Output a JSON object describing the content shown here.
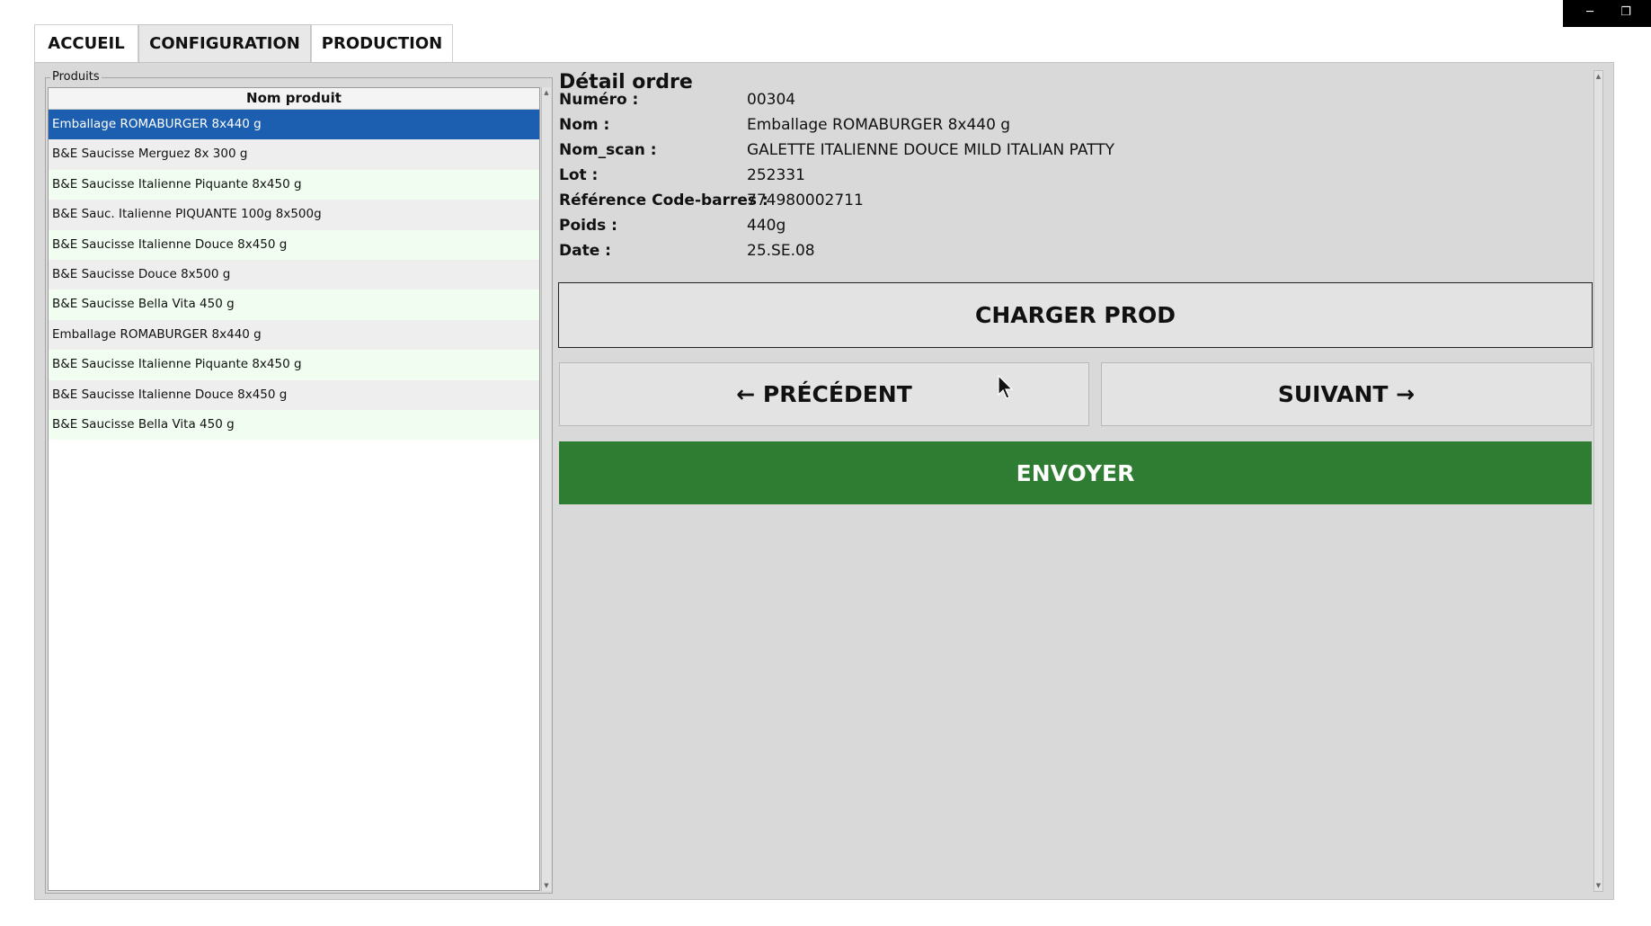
{
  "window": {
    "minimize_icon": "─",
    "restore_icon": "❐"
  },
  "tabs": [
    {
      "label": "ACCUEIL"
    },
    {
      "label": "CONFIGURATION",
      "active": true
    },
    {
      "label": "PRODUCTION"
    }
  ],
  "products": {
    "group_title": "Produits",
    "column_header": "Nom produit",
    "items": [
      "Emballage ROMABURGER 8x440 g",
      "B&E Saucisse Merguez 8x 300 g",
      "B&E Saucisse Italienne Piquante 8x450 g",
      "B&E Sauc. Italienne PIQUANTE 100g  8x500g",
      "B&E Saucisse Italienne Douce 8x450 g",
      "B&E Saucisse Douce 8x500 g",
      "B&E Saucisse Bella Vita 450 g",
      "Emballage ROMABURGER 8x440 g",
      "B&E Saucisse Italienne Piquante 8x450 g",
      "B&E Saucisse Italienne Douce 8x450 g",
      "B&E Saucisse Bella Vita 450 g"
    ],
    "selected_index": 0
  },
  "detail": {
    "title": "Détail ordre",
    "fields": [
      {
        "label": "Numéro :",
        "value": "00304"
      },
      {
        "label": "Nom :",
        "value": "Emballage ROMABURGER 8x440 g"
      },
      {
        "label": "Nom_scan :",
        "value": "GALETTE ITALIENNE DOUCE MILD ITALIAN PATTY"
      },
      {
        "label": "Lot :",
        "value": "252331"
      },
      {
        "label": "Référence Code-barres :",
        "value": "774980002711"
      },
      {
        "label": "Poids :",
        "value": "440g"
      },
      {
        "label": "Date :",
        "value": "25.SE.08"
      }
    ]
  },
  "buttons": {
    "charger": "CHARGER PROD",
    "previous": "← PRÉCÉDENT",
    "next": "SUIVANT →",
    "send": "ENVOYER"
  },
  "colors": {
    "selected_row": "#1c5fb1",
    "send_button": "#2e7d32",
    "panel_bg": "#d9d9d9"
  }
}
